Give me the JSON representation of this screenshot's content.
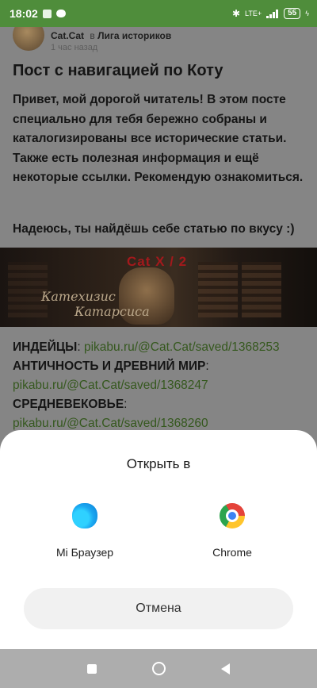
{
  "status_bar": {
    "time": "18:02",
    "network": "LTE+",
    "battery": "55"
  },
  "post": {
    "author": "Cat.Cat",
    "in_word": "в",
    "group": "Лига историков",
    "time": "1 час назад",
    "title": "Пост с навигацией по Коту",
    "body": "Привет, мой дорогой читатель! В этом посте специально для тебя бережно собраны и каталогизированы все исторические статьи. Также есть полезная информация и ещё некоторые ссылки. Рекомендую ознакомиться.",
    "body2": "Надеюсь, ты найдёшь себе статью по вкусу :)",
    "banner": {
      "title": "Cat X / 2",
      "subtitle_line1": "Катехизис",
      "subtitle_line2": "Катарсиса"
    },
    "links": [
      {
        "heading": "ИНДЕЙЦЫ",
        "url": "pikabu.ru/@Cat.Cat/saved/1368253"
      },
      {
        "heading": "АНТИЧНОСТЬ И ДРЕВНИЙ МИР",
        "url": "pikabu.ru/@Cat.Cat/saved/1368247"
      },
      {
        "heading": "СРЕДНЕВЕКОВЬЕ",
        "url": "pikabu.ru/@Cat.Cat/saved/1368260"
      }
    ]
  },
  "sheet": {
    "title": "Открыть в",
    "apps": [
      {
        "label": "Mi Браузер",
        "icon": "mi-browser-icon"
      },
      {
        "label": "Chrome",
        "icon": "chrome-icon"
      }
    ],
    "cancel_label": "Отмена"
  },
  "nav": {
    "recent_icon": "square-recents-icon",
    "home_icon": "circle-home-icon",
    "back_icon": "triangle-back-icon"
  }
}
